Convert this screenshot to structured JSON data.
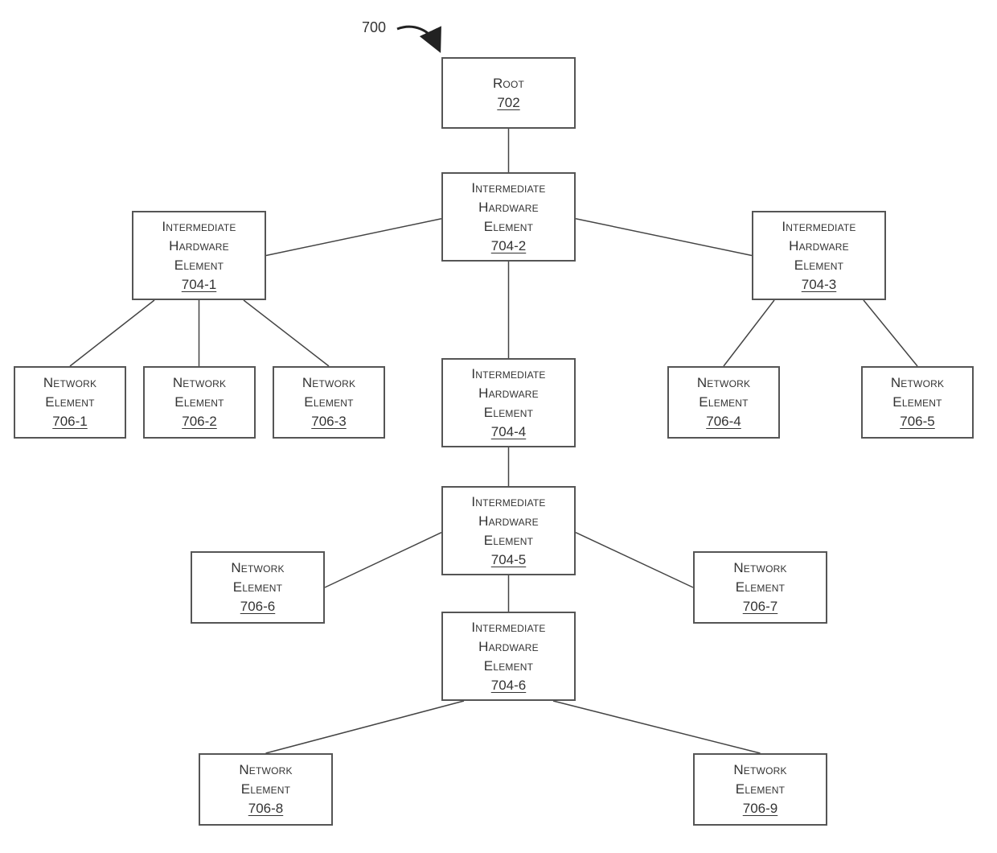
{
  "figure": {
    "label": "700"
  },
  "nodes": {
    "root": {
      "lines": [
        "Root"
      ],
      "ref": "702"
    },
    "ihe_704_1": {
      "lines": [
        "Intermediate",
        "Hardware",
        "Element"
      ],
      "ref": "704-1"
    },
    "ihe_704_2": {
      "lines": [
        "Intermediate",
        "Hardware",
        "Element"
      ],
      "ref": "704-2"
    },
    "ihe_704_3": {
      "lines": [
        "Intermediate",
        "Hardware",
        "Element"
      ],
      "ref": "704-3"
    },
    "ihe_704_4": {
      "lines": [
        "Intermediate",
        "Hardware",
        "Element"
      ],
      "ref": "704-4"
    },
    "ihe_704_5": {
      "lines": [
        "Intermediate",
        "Hardware",
        "Element"
      ],
      "ref": "704-5"
    },
    "ihe_704_6": {
      "lines": [
        "Intermediate",
        "Hardware",
        "Element"
      ],
      "ref": "704-6"
    },
    "ne_706_1": {
      "lines": [
        "Network",
        "Element"
      ],
      "ref": "706-1"
    },
    "ne_706_2": {
      "lines": [
        "Network",
        "Element"
      ],
      "ref": "706-2"
    },
    "ne_706_3": {
      "lines": [
        "Network",
        "Element"
      ],
      "ref": "706-3"
    },
    "ne_706_4": {
      "lines": [
        "Network",
        "Element"
      ],
      "ref": "706-4"
    },
    "ne_706_5": {
      "lines": [
        "Network",
        "Element"
      ],
      "ref": "706-5"
    },
    "ne_706_6": {
      "lines": [
        "Network",
        "Element"
      ],
      "ref": "706-6"
    },
    "ne_706_7": {
      "lines": [
        "Network",
        "Element"
      ],
      "ref": "706-7"
    },
    "ne_706_8": {
      "lines": [
        "Network",
        "Element"
      ],
      "ref": "706-8"
    },
    "ne_706_9": {
      "lines": [
        "Network",
        "Element"
      ],
      "ref": "706-9"
    }
  },
  "edges": [
    [
      "root",
      "ihe_704_2"
    ],
    [
      "ihe_704_2",
      "ihe_704_1"
    ],
    [
      "ihe_704_2",
      "ihe_704_3"
    ],
    [
      "ihe_704_2",
      "ihe_704_4"
    ],
    [
      "ihe_704_1",
      "ne_706_1"
    ],
    [
      "ihe_704_1",
      "ne_706_2"
    ],
    [
      "ihe_704_1",
      "ne_706_3"
    ],
    [
      "ihe_704_3",
      "ne_706_4"
    ],
    [
      "ihe_704_3",
      "ne_706_5"
    ],
    [
      "ihe_704_4",
      "ihe_704_5"
    ],
    [
      "ihe_704_5",
      "ne_706_6"
    ],
    [
      "ihe_704_5",
      "ne_706_7"
    ],
    [
      "ihe_704_5",
      "ihe_704_6"
    ],
    [
      "ihe_704_6",
      "ne_706_8"
    ],
    [
      "ihe_704_6",
      "ne_706_9"
    ]
  ]
}
